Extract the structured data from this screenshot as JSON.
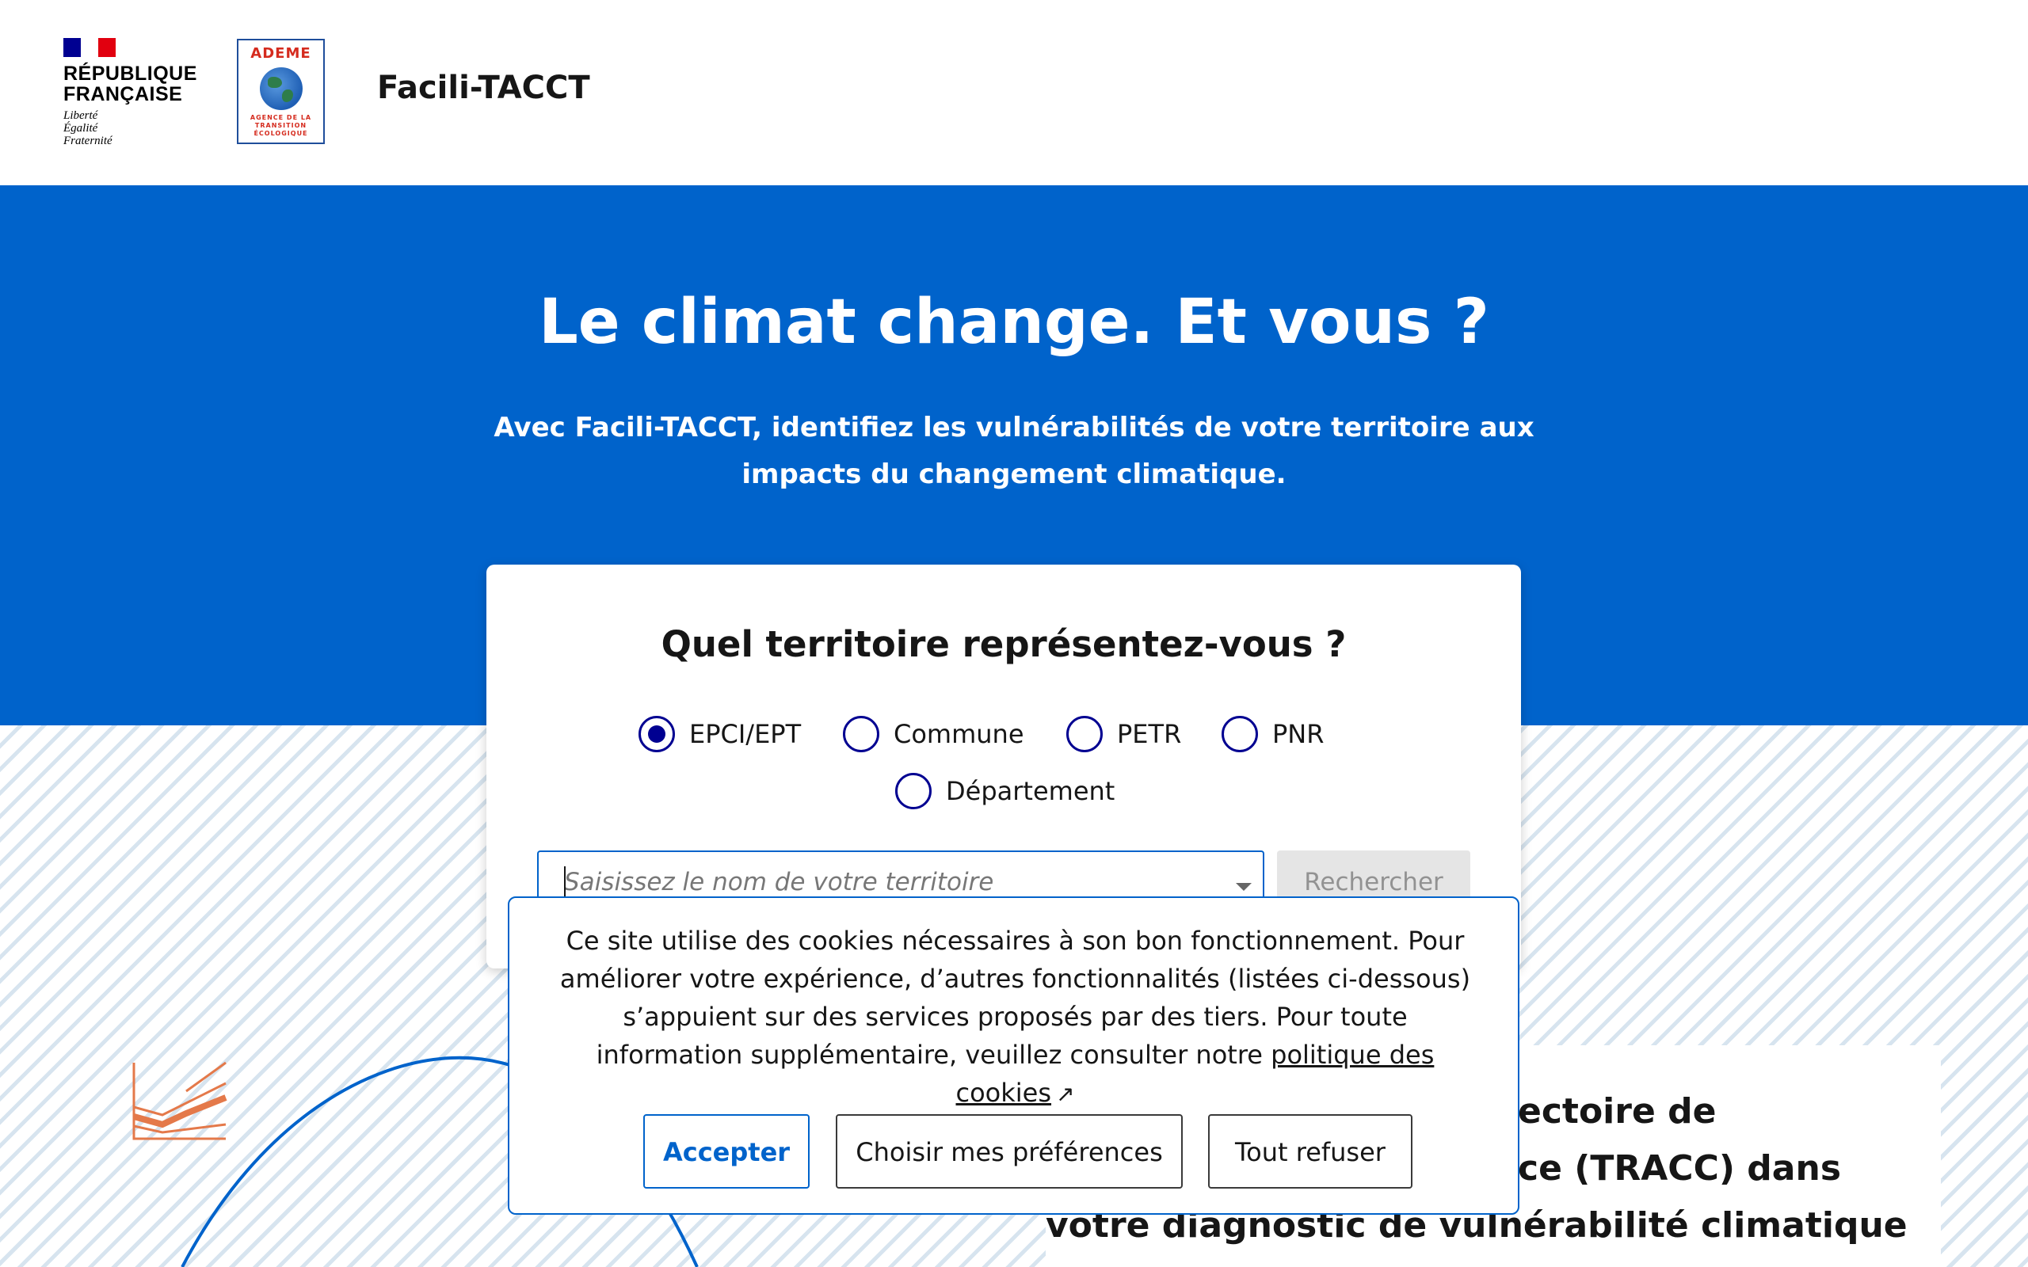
{
  "header": {
    "republic_title_line1": "RÉPUBLIQUE",
    "republic_title_line2": "FRANÇAISE",
    "motto_1": "Liberté",
    "motto_2": "Égalité",
    "motto_3": "Fraternité",
    "ademe_name": "ADEME",
    "ademe_subtitle": "AGENCE DE LA TRANSITION ÉCOLOGIQUE",
    "site_title": "Facili-TACCT"
  },
  "hero": {
    "title": "Le climat change. Et vous ?",
    "subtitle": "Avec Facili-TACCT, identifiez les vulnérabilités de votre territoire aux impacts du changement climatique."
  },
  "territory_card": {
    "question": "Quel territoire représentez-vous ?",
    "options": [
      "EPCI/EPT",
      "Commune",
      "PETR",
      "PNR",
      "Département"
    ],
    "selected": "EPCI/EPT",
    "search_placeholder": "Saisissez le nom de votre territoire",
    "search_button": "Rechercher"
  },
  "background_section": {
    "line1": "ectoire de",
    "line2": "ce (TRACC) dans",
    "line3": "votre diagnostic de vulnérabilité climatique"
  },
  "cookie_banner": {
    "text": "Ce site utilise des cookies nécessaires à son bon fonctionnement. Pour améliorer votre expérience, d’autres fonctionnalités (listées ci-dessous) s’appuient sur des services proposés par des tiers. Pour toute information supplémentaire, veuillez consulter notre",
    "link_text": "politique des cookies",
    "accept": "Accepter",
    "preferences": "Choisir mes préférences",
    "refuse": "Tout refuser"
  },
  "colors": {
    "primary_blue": "#0063cb",
    "dark_blue": "#000091",
    "marianne_red": "#e1000f",
    "accent_orange": "#e4794a"
  }
}
